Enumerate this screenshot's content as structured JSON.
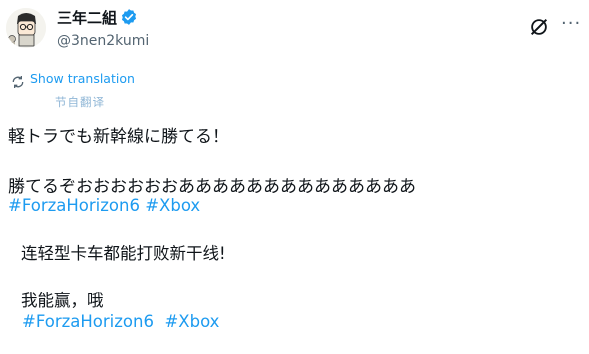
{
  "author": {
    "display_name": "三年二組",
    "handle": "@3nen2kumi"
  },
  "translation": {
    "show_label": "Show translation",
    "byline": "节自翻译"
  },
  "post": {
    "line1": "軽トラでも新幹線に勝てる！",
    "line2": "勝てるぞおおおおおおああああああああああああああ",
    "hashtags": [
      "#ForzaHorizon6",
      "#Xbox"
    ]
  },
  "translated": {
    "line1": "连轻型卡车都能打败新干线!",
    "line2": "我能赢，哦",
    "hashtags": [
      "#ForzaHorizon6",
      "#Xbox"
    ]
  },
  "icons": {
    "verified": "verified-badge-icon",
    "grok": "grok-icon",
    "more": "more-options-icon",
    "translate": "translate-icon"
  },
  "colors": {
    "accent": "#1d9bf0",
    "text": "#0f1419",
    "muted": "#536471"
  }
}
